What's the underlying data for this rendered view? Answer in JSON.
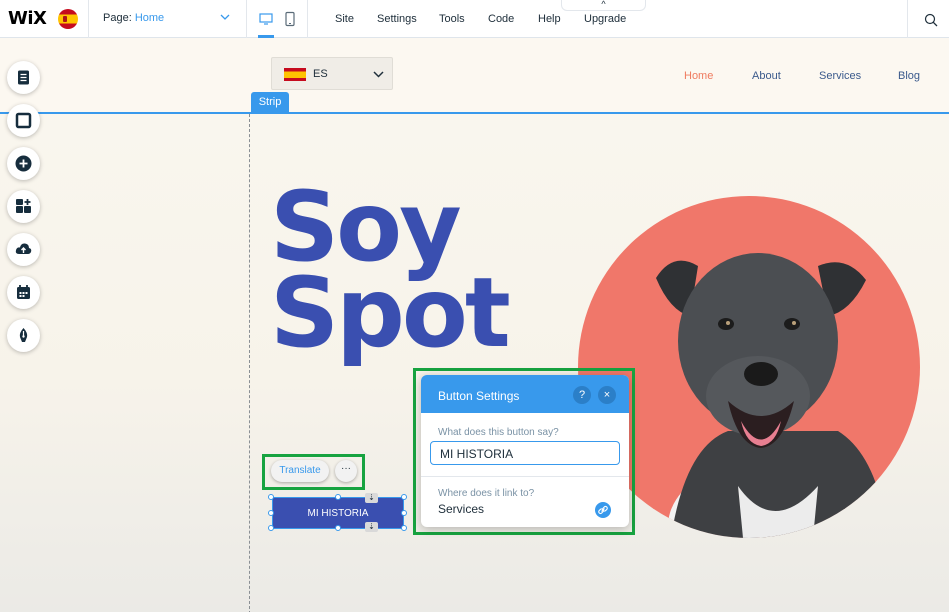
{
  "topbar": {
    "logo": "WiX",
    "page_label": "Page:",
    "page_value": "Home",
    "menu": [
      "Site",
      "Settings",
      "Tools",
      "Code",
      "Help",
      "Upgrade"
    ],
    "upgrade_caret": "^"
  },
  "canvas": {
    "language": {
      "code": "ES"
    },
    "strip_tag": "Strip",
    "nav": [
      "Home",
      "About",
      "Services",
      "Blog"
    ],
    "hero_line1": "Soy",
    "hero_line2": "Spot",
    "translate_label": "Translate",
    "more_label": "···",
    "button_label": "MI HISTORIA",
    "stretch_glyph": "⇣"
  },
  "button_settings": {
    "title": "Button Settings",
    "help": "?",
    "close": "×",
    "text_question": "What does this button say?",
    "text_value": "MI HISTORIA",
    "link_question": "Where does it link to?",
    "link_value": "Services"
  },
  "colors": {
    "accent": "#3899ec",
    "hero": "#3a4fb0",
    "nav_active": "#ef7b5f",
    "circle": "#f0776a",
    "highlight": "#17a340"
  }
}
